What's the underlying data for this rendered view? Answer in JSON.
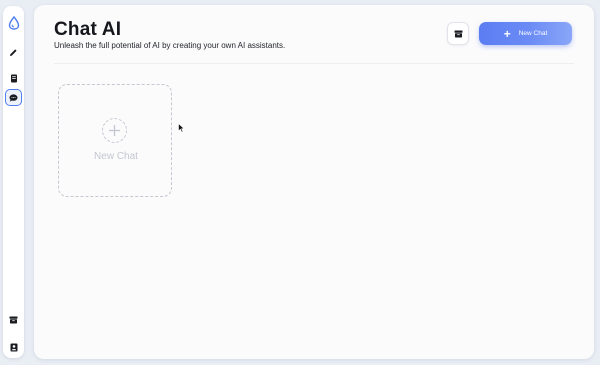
{
  "sidebar": {
    "items": [
      {
        "icon": "drop-logo-icon",
        "active": false
      },
      {
        "icon": "pencil-icon",
        "active": false
      },
      {
        "icon": "document-icon",
        "active": false
      },
      {
        "icon": "chat-bubble-icon",
        "active": true
      },
      {
        "icon": "archive-icon",
        "active": false
      },
      {
        "icon": "contacts-icon",
        "active": false
      }
    ]
  },
  "header": {
    "title": "Chat AI",
    "subtitle": "Unleash the full potential of AI by creating your own AI assistants."
  },
  "toolbar": {
    "archive_icon": "archive-icon",
    "new_chat_label": "New Chat",
    "new_chat_icon": "plus-icon"
  },
  "cards": {
    "new_chat_label": "New Chat"
  },
  "colors": {
    "accent": "#5b7df2",
    "background": "#e9edf4",
    "panel": "#fbfbfc"
  }
}
